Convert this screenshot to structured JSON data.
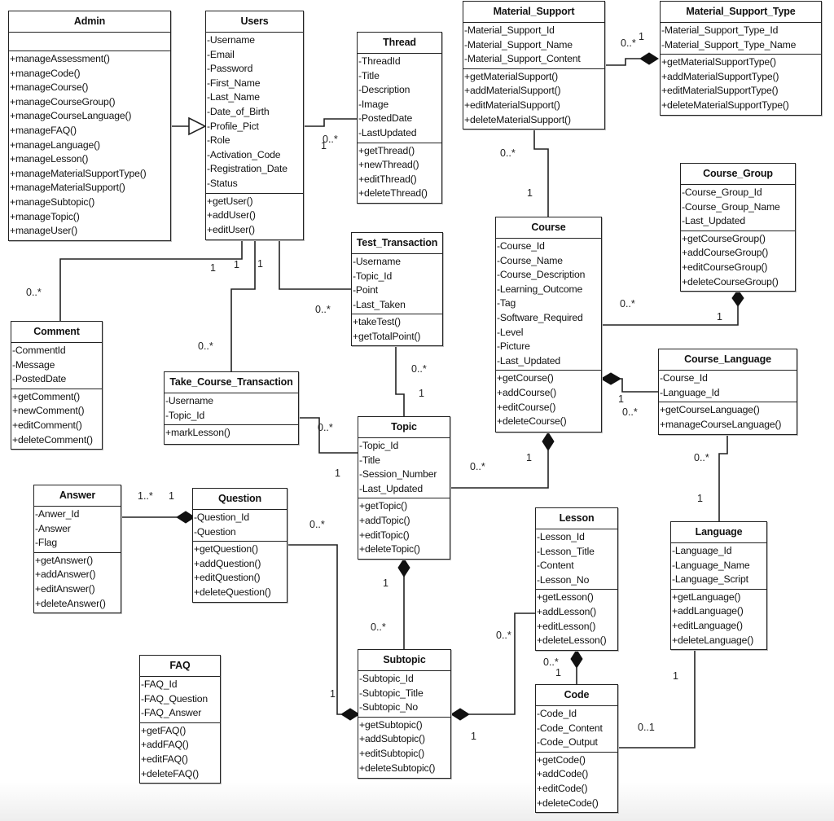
{
  "diagram": {
    "type": "UML class diagram",
    "classes": {
      "admin": {
        "name": "Admin",
        "attributes": [],
        "operations": [
          "+manageAssessment()",
          "+manageCode()",
          "+manageCourse()",
          "+manageCourseGroup()",
          "+manageCourseLanguage()",
          "+manageFAQ()",
          "+manageLanguage()",
          "+manageLesson()",
          "+manageMaterialSupportType()",
          "+manageMaterialSupport()",
          "+manageSubtopic()",
          "+manageTopic()",
          "+manageUser()"
        ]
      },
      "users": {
        "name": "Users",
        "attributes": [
          "-Username",
          "-Email",
          "-Password",
          "-First_Name",
          "-Last_Name",
          "-Date_of_Birth",
          "-Profile_Pict",
          "-Role",
          "-Activation_Code",
          "-Registration_Date",
          "-Status"
        ],
        "operations": [
          "+getUser()",
          "+addUser()",
          "+editUser()"
        ]
      },
      "thread": {
        "name": "Thread",
        "attributes": [
          "-ThreadId",
          "-Title",
          "-Description",
          "-Image",
          "-PostedDate",
          "-LastUpdated"
        ],
        "operations": [
          "+getThread()",
          "+newThread()",
          "+editThread()",
          "+deleteThread()"
        ]
      },
      "material_support": {
        "name": "Material_Support",
        "attributes": [
          "-Material_Support_Id",
          "-Material_Support_Name",
          "-Material_Support_Content"
        ],
        "operations": [
          "+getMaterialSupport()",
          "+addMaterialSupport()",
          "+editMaterialSupport()",
          "+deleteMaterialSupport()"
        ]
      },
      "material_support_type": {
        "name": "Material_Support_Type",
        "attributes": [
          "-Material_Support_Type_Id",
          "-Material_Support_Type_Name"
        ],
        "operations": [
          "+getMaterialSupportType()",
          "+addMaterialSupportType()",
          "+editMaterialSupportType()",
          "+deleteMaterialSupportType()"
        ]
      },
      "course_group": {
        "name": "Course_Group",
        "attributes": [
          "-Course_Group_Id",
          "-Course_Group_Name",
          "-Last_Updated"
        ],
        "operations": [
          "+getCourseGroup()",
          "+addCourseGroup()",
          "+editCourseGroup()",
          "+deleteCourseGroup()"
        ]
      },
      "course": {
        "name": "Course",
        "attributes": [
          "-Course_Id",
          "-Course_Name",
          "-Course_Description",
          "-Learning_Outcome",
          "-Tag",
          "-Software_Required",
          "-Level",
          "-Picture",
          "-Last_Updated"
        ],
        "operations": [
          "+getCourse()",
          "+addCourse()",
          "+editCourse()",
          "+deleteCourse()"
        ]
      },
      "test_transaction": {
        "name": "Test_Transaction",
        "attributes": [
          "-Username",
          "-Topic_Id",
          "-Point",
          "-Last_Taken"
        ],
        "operations": [
          "+takeTest()",
          "+getTotalPoint()"
        ]
      },
      "comment": {
        "name": "Comment",
        "attributes": [
          "-CommentId",
          "-Message",
          "-PostedDate"
        ],
        "operations": [
          "+getComment()",
          "+newComment()",
          "+editComment()",
          "+deleteComment()"
        ]
      },
      "take_course_transaction": {
        "name": "Take_Course_Transaction",
        "attributes": [
          "-Username",
          "-Topic_Id"
        ],
        "operations": [
          "+markLesson()"
        ]
      },
      "course_language": {
        "name": "Course_Language",
        "attributes": [
          "-Course_Id",
          "-Language_Id"
        ],
        "operations": [
          "+getCourseLanguage()",
          "+manageCourseLanguage()"
        ]
      },
      "topic": {
        "name": "Topic",
        "attributes": [
          "-Topic_Id",
          "-Title",
          "-Session_Number",
          "-Last_Updated"
        ],
        "operations": [
          "+getTopic()",
          "+addTopic()",
          "+editTopic()",
          "+deleteTopic()"
        ]
      },
      "answer": {
        "name": "Answer",
        "attributes": [
          "-Anwer_Id",
          "-Answer",
          "-Flag"
        ],
        "operations": [
          "+getAnswer()",
          "+addAnswer()",
          "+editAnswer()",
          "+deleteAnswer()"
        ]
      },
      "question": {
        "name": "Question",
        "attributes": [
          "-Question_Id",
          "-Question"
        ],
        "operations": [
          "+getQuestion()",
          "+addQuestion()",
          "+editQuestion()",
          "+deleteQuestion()"
        ]
      },
      "lesson": {
        "name": "Lesson",
        "attributes": [
          "-Lesson_Id",
          "-Lesson_Title",
          "-Content",
          "-Lesson_No"
        ],
        "operations": [
          "+getLesson()",
          "+addLesson()",
          "+editLesson()",
          "+deleteLesson()"
        ]
      },
      "language": {
        "name": "Language",
        "attributes": [
          "-Language_Id",
          "-Language_Name",
          "-Language_Script"
        ],
        "operations": [
          "+getLanguage()",
          "+addLanguage()",
          "+editLanguage()",
          "+deleteLanguage()"
        ]
      },
      "faq": {
        "name": "FAQ",
        "attributes": [
          "-FAQ_Id",
          "-FAQ_Question",
          "-FAQ_Answer"
        ],
        "operations": [
          "+getFAQ()",
          "+addFAQ()",
          "+editFAQ()",
          "+deleteFAQ()"
        ]
      },
      "subtopic": {
        "name": "Subtopic",
        "attributes": [
          "-Subtopic_Id",
          "-Subtopic_Title",
          "-Subtopic_No"
        ],
        "operations": [
          "+getSubtopic()",
          "+addSubtopic()",
          "+editSubtopic()",
          "+deleteSubtopic()"
        ]
      },
      "code": {
        "name": "Code",
        "attributes": [
          "-Code_Id",
          "-Code_Content",
          "-Code_Output"
        ],
        "operations": [
          "+getCode()",
          "+addCode()",
          "+editCode()",
          "+deleteCode()"
        ]
      }
    },
    "relationships": [
      {
        "from": "Admin",
        "to": "Users",
        "kind": "generalization"
      },
      {
        "from": "Users",
        "to": "Thread",
        "kind": "association",
        "from_mult": "1",
        "to_mult": "0..*"
      },
      {
        "from": "Users",
        "to": "Comment",
        "kind": "association",
        "from_mult": "1",
        "to_mult": "0..*"
      },
      {
        "from": "Users",
        "to": "Take_Course_Transaction",
        "kind": "association",
        "from_mult": "1",
        "to_mult": "0..*"
      },
      {
        "from": "Users",
        "to": "Test_Transaction",
        "kind": "association",
        "from_mult": "1",
        "to_mult": "0..*"
      },
      {
        "from": "Material_Support_Type",
        "to": "Material_Support",
        "kind": "composition",
        "from_mult": "1",
        "to_mult": "0..*"
      },
      {
        "from": "Material_Support",
        "to": "Course",
        "kind": "association",
        "from_mult": "0..*",
        "to_mult": "1"
      },
      {
        "from": "Course_Group",
        "to": "Course",
        "kind": "composition",
        "from_mult": "1",
        "to_mult": "0..*"
      },
      {
        "from": "Course",
        "to": "Course_Language",
        "kind": "composition",
        "from_mult": "1",
        "to_mult": "0..*"
      },
      {
        "from": "Course",
        "to": "Topic",
        "kind": "composition",
        "from_mult": "1",
        "to_mult": "0..*"
      },
      {
        "from": "Test_Transaction",
        "to": "Topic",
        "kind": "association",
        "from_mult": "0..*",
        "to_mult": "1"
      },
      {
        "from": "Take_Course_Transaction",
        "to": "Topic",
        "kind": "association",
        "from_mult": "0..*",
        "to_mult": "1"
      },
      {
        "from": "Question",
        "to": "Answer",
        "kind": "composition",
        "from_mult": "1",
        "to_mult": "1..*"
      },
      {
        "from": "Topic",
        "to": "Subtopic",
        "kind": "composition",
        "from_mult": "1",
        "to_mult": "0..*"
      },
      {
        "from": "Subtopic",
        "to": "Question",
        "kind": "composition",
        "from_mult": "1",
        "to_mult": "0..*"
      },
      {
        "from": "Subtopic",
        "to": "Lesson",
        "kind": "composition",
        "from_mult": "1",
        "to_mult": "0..*"
      },
      {
        "from": "Lesson",
        "to": "Code",
        "kind": "composition",
        "from_mult": "1",
        "to_mult": "0..*"
      },
      {
        "from": "Language",
        "to": "Course_Language",
        "kind": "association",
        "from_mult": "1",
        "to_mult": "0..*"
      },
      {
        "from": "Language",
        "to": "Code",
        "kind": "association",
        "from_mult": "1",
        "to_mult": "0..1"
      }
    ],
    "labels": {
      "users_thread_1": "1",
      "users_thread_many": "0..*",
      "users_comment_1": "1",
      "users_comment_many": "0..*",
      "users_take_1": "1",
      "users_take_many": "0..*",
      "users_test_1": "1",
      "users_test_many": "0..*",
      "ms_mst_many": "0..*",
      "ms_mst_1": "1",
      "ms_course_many": "0..*",
      "ms_course_1": "1",
      "course_group_many": "0..*",
      "course_group_1": "1",
      "course_cl_1": "1",
      "course_cl_many": "0..*",
      "test_topic_many": "0..*",
      "test_topic_1": "1",
      "take_topic_many": "0..*",
      "take_topic_1": "1",
      "course_topic_many": "0..*",
      "course_topic_1": "1",
      "answer_question_many": "1..*",
      "answer_question_1": "1",
      "question_subtopic_many": "0..*",
      "question_subtopic_1": "1",
      "topic_subtopic_1": "1",
      "topic_subtopic_many": "0..*",
      "lesson_subtopic_many": "0..*",
      "lesson_subtopic_1": "1",
      "lesson_code_many": "0..*",
      "lesson_code_1": "1",
      "cl_language_many": "0..*",
      "cl_language_1": "1",
      "language_code_1": "1",
      "language_code_01": "0..1"
    }
  }
}
